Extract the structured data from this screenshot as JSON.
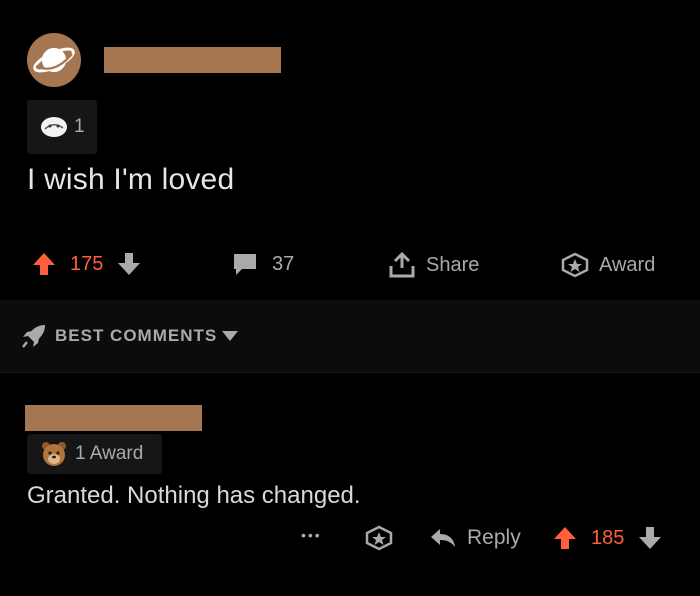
{
  "post": {
    "award_count": "1",
    "title": "I wish I'm loved",
    "upvotes": "175",
    "comments": "37",
    "share_label": "Share",
    "award_label": "Award"
  },
  "sort": {
    "label": "BEST COMMENTS"
  },
  "comment": {
    "award_label": "1 Award",
    "text": "Granted. Nothing has changed.",
    "more_label": "•••",
    "reply_label": "Reply",
    "upvotes": "185"
  },
  "colors": {
    "background": "#000000",
    "upvote_accent": "#ff5f3b",
    "redaction": "#a57652",
    "muted_text": "#a8aaab"
  }
}
